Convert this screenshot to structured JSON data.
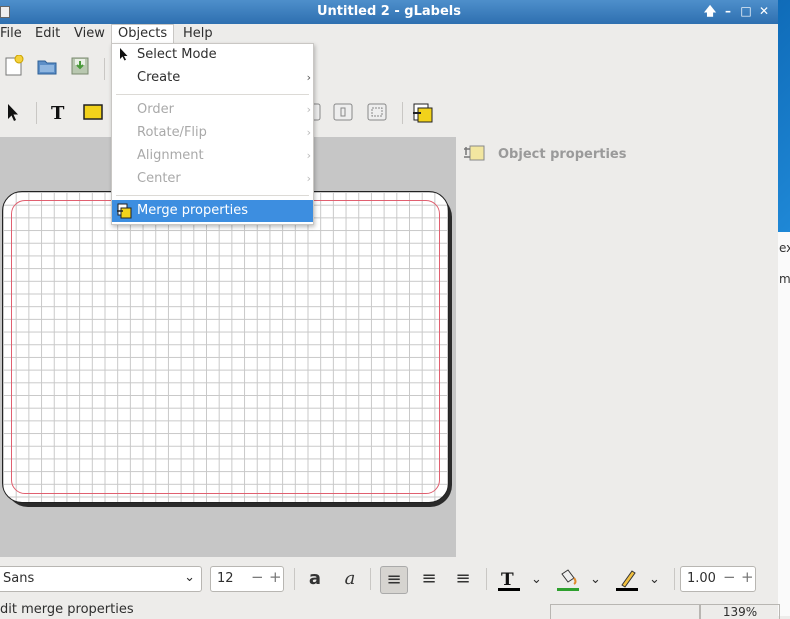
{
  "window": {
    "title": "Untitled 2 - gLabels"
  },
  "menubar": {
    "items": [
      "File",
      "Edit",
      "View",
      "Objects",
      "Help"
    ]
  },
  "objects_menu": {
    "items": [
      {
        "label": "Select Mode",
        "enabled": true,
        "submenu": false
      },
      {
        "label": "Create",
        "enabled": true,
        "submenu": true
      },
      {
        "label": "Order",
        "enabled": false,
        "submenu": true
      },
      {
        "label": "Rotate/Flip",
        "enabled": false,
        "submenu": true
      },
      {
        "label": "Alignment",
        "enabled": false,
        "submenu": true
      },
      {
        "label": "Center",
        "enabled": false,
        "submenu": true
      },
      {
        "label": "Merge properties",
        "enabled": true,
        "submenu": false,
        "highlighted": true
      }
    ]
  },
  "props_panel": {
    "title": "Object properties"
  },
  "text_toolbar": {
    "font_family": "Sans",
    "font_size": "12",
    "line_width": "1.00"
  },
  "statusbar": {
    "message": "dit merge properties",
    "zoom": "139%"
  },
  "background_fragments": [
    "ex",
    "m"
  ],
  "colors": {
    "titlebar": "#3a7bbd",
    "highlight": "#3d8ee0",
    "label_margin": "#e06070",
    "canvas_bg": "#c6c6c6"
  }
}
